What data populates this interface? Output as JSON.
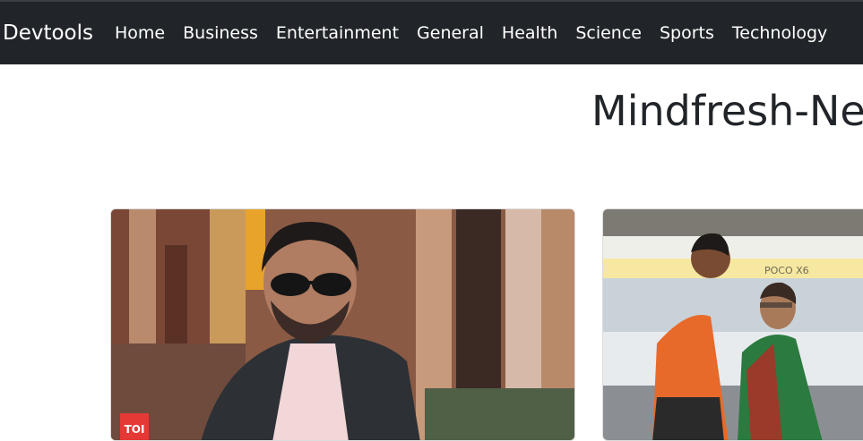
{
  "navbar": {
    "brand": "Devtools",
    "links": [
      "Home",
      "Business",
      "Entertainment",
      "General",
      "Health",
      "Science",
      "Sports",
      "Technology"
    ]
  },
  "page": {
    "title": "Mindfresh-Ne"
  },
  "cards": [
    {
      "image_badge": "TOI"
    },
    {
      "stadium_banner": "POCO X6"
    }
  ],
  "colors": {
    "navbar_bg": "#212529",
    "nav_text": "#ffffff",
    "title_text": "#212529"
  }
}
